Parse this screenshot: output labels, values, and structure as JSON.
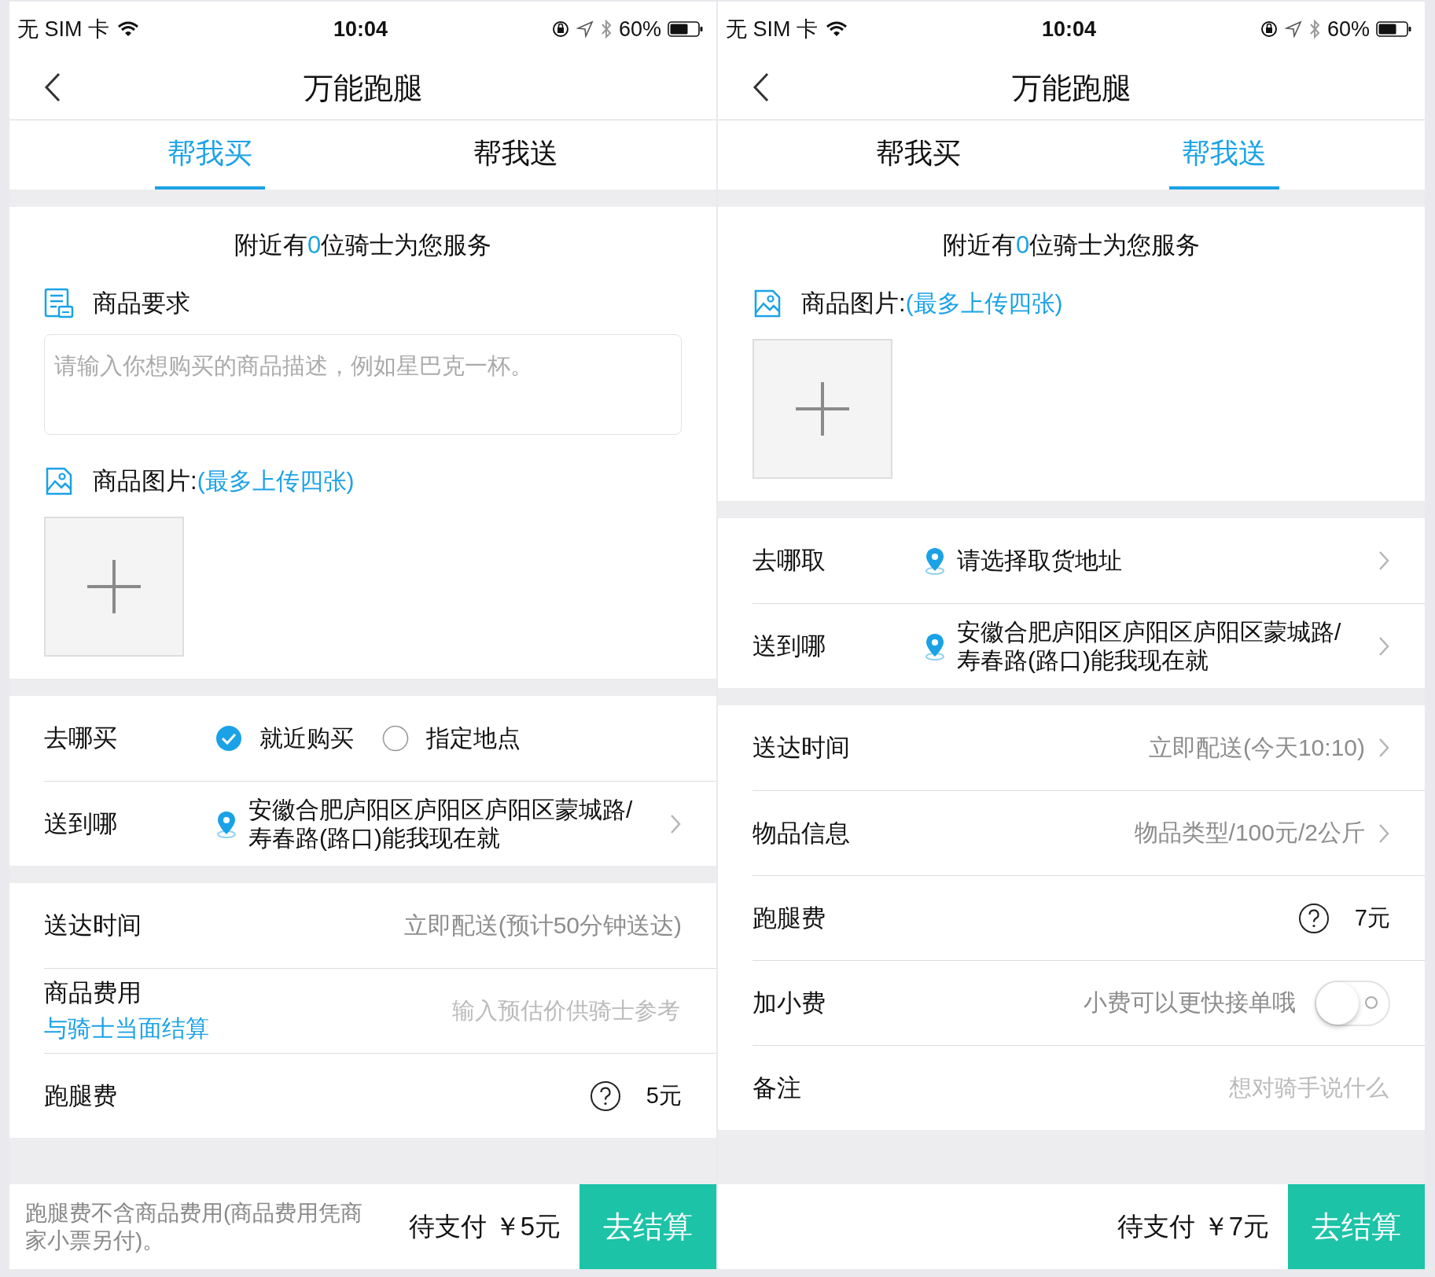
{
  "screens": [
    {
      "status": {
        "carrier": "无 SIM 卡",
        "time": "10:04",
        "battery": "60%"
      },
      "title": "万能跑腿",
      "tabs": [
        {
          "label": "帮我买",
          "selected": true
        },
        {
          "label": "帮我送",
          "selected": false
        }
      ],
      "sections": [
        {
          "items": [
            {
              "kind": "riders",
              "prefix": "附近有",
              "count": "0",
              "suffix": "位骑士为您服务"
            },
            {
              "kind": "requirement_heading",
              "label": "商品要求"
            },
            {
              "kind": "textarea",
              "placeholder": "请输入你想购买的商品描述，例如星巴克一杯。"
            },
            {
              "kind": "photo_heading",
              "label": "商品图片:",
              "hint": "(最多上传四张)"
            },
            {
              "kind": "upload"
            }
          ]
        },
        {
          "items": [
            {
              "kind": "radio",
              "label": "去哪买",
              "options": [
                {
                  "label": "就近购买",
                  "selected": true
                },
                {
                  "label": "指定地点",
                  "selected": false
                }
              ]
            },
            {
              "kind": "address",
              "label": "送到哪",
              "value": "安徽合肥庐阳区庐阳区庐阳区蒙城路/\n寿春路(路口)能我现在就",
              "chevron": true
            }
          ]
        },
        {
          "items": [
            {
              "kind": "value",
              "label": "送达时间",
              "value": "立即配送(预计50分钟送达)",
              "chevron": false
            },
            {
              "kind": "input",
              "label": "商品费用",
              "sublabel": "与骑士当面结算",
              "placeholder": "输入预估价供骑士参考"
            },
            {
              "kind": "fee",
              "label": "跑腿费",
              "amount": "5元"
            }
          ]
        }
      ],
      "footer": {
        "note": "跑腿费不含商品费用(商品费用凭商家小票另付)。",
        "total": "待支付 ￥5元",
        "button": "去结算"
      }
    },
    {
      "status": {
        "carrier": "无 SIM 卡",
        "time": "10:04",
        "battery": "60%"
      },
      "title": "万能跑腿",
      "tabs": [
        {
          "label": "帮我买",
          "selected": false
        },
        {
          "label": "帮我送",
          "selected": true
        }
      ],
      "sections": [
        {
          "items": [
            {
              "kind": "riders",
              "prefix": "附近有",
              "count": "0",
              "suffix": "位骑士为您服务"
            },
            {
              "kind": "photo_heading",
              "label": "商品图片:",
              "hint": "(最多上传四张)"
            },
            {
              "kind": "upload"
            }
          ]
        },
        {
          "items": [
            {
              "kind": "address",
              "label": "去哪取",
              "value": "请选择取货地址",
              "chevron": true
            },
            {
              "kind": "address",
              "label": "送到哪",
              "value": "安徽合肥庐阳区庐阳区庐阳区蒙城路/\n寿春路(路口)能我现在就",
              "chevron": true
            }
          ]
        },
        {
          "items": [
            {
              "kind": "value",
              "label": "送达时间",
              "value": "立即配送(今天10:10)",
              "chevron": true
            },
            {
              "kind": "value",
              "label": "物品信息",
              "value": "物品类型/100元/2公斤",
              "chevron": true
            },
            {
              "kind": "fee",
              "label": "跑腿费",
              "amount": "7元"
            },
            {
              "kind": "toggle",
              "label": "加小费",
              "hint": "小费可以更快接单哦",
              "on": false
            },
            {
              "kind": "input",
              "label": "备注",
              "placeholder": "想对骑手说什么"
            }
          ]
        }
      ],
      "footer": {
        "total": "待支付 ￥7元",
        "button": "去结算"
      }
    }
  ]
}
